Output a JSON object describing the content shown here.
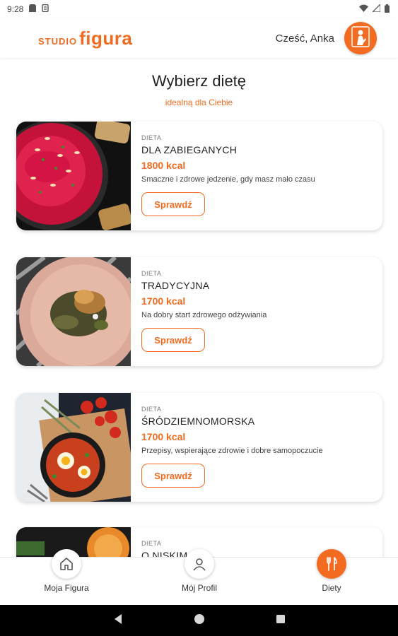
{
  "status_bar": {
    "time": "9:28"
  },
  "header": {
    "logo_small": "STUDIO",
    "logo_big": "figura",
    "greeting": "Cześć, Anka",
    "avatar_icon": "person-icon"
  },
  "page": {
    "title": "Wybierz dietę",
    "subtitle": "idealną dla Ciebie"
  },
  "diets": [
    {
      "label": "DIETA",
      "name": "DLA ZABIEGANYCH",
      "kcal": "1800 kcal",
      "description": "Smaczne i zdrowe jedzenie, gdy masz mało czasu",
      "button": "Sprawdź"
    },
    {
      "label": "DIETA",
      "name": "TRADYCYJNA",
      "kcal": "1700 kcal",
      "description": "Na dobry start zdrowego odżywiania",
      "button": "Sprawdź"
    },
    {
      "label": "DIETA",
      "name": "ŚRÓDZIEMNOMORSKA",
      "kcal": "1700 kcal",
      "description": "Przepisy, wspierające zdrowie i dobre samopoczucie",
      "button": "Sprawdź"
    },
    {
      "label": "DIETA",
      "name": "O NISKIM",
      "kcal": "",
      "description": "",
      "button": ""
    }
  ],
  "bottom_nav": [
    {
      "label": "Moja Figura",
      "icon": "home-icon"
    },
    {
      "label": "Mój Profil",
      "icon": "profile-icon"
    },
    {
      "label": "Diety",
      "icon": "fork-knife-icon"
    }
  ],
  "colors": {
    "accent": "#f26b21"
  }
}
